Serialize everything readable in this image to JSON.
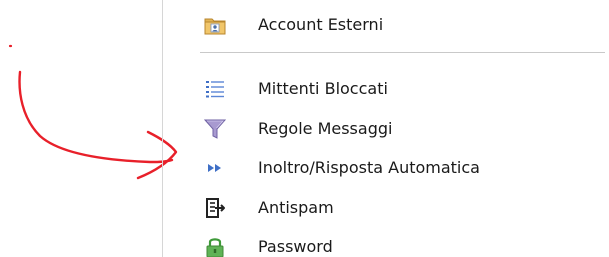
{
  "menu": {
    "items": [
      {
        "label": "Account Esterni",
        "icon": "folder-contact-icon"
      },
      {
        "label": "Mittenti Bloccati",
        "icon": "list-icon"
      },
      {
        "label": "Regole Messaggi",
        "icon": "filter-funnel-icon"
      },
      {
        "label": "Inoltro/Risposta Automatica",
        "icon": "forward-arrows-icon"
      },
      {
        "label": "Antispam",
        "icon": "antispam-icon"
      },
      {
        "label": "Password",
        "icon": "lock-icon"
      }
    ]
  },
  "colors": {
    "annotation": "#e8202a",
    "funnel": "#8a7ab8",
    "forward": "#3f6fc6",
    "lock": "#3f9a3a",
    "folder": "#d9a545"
  }
}
